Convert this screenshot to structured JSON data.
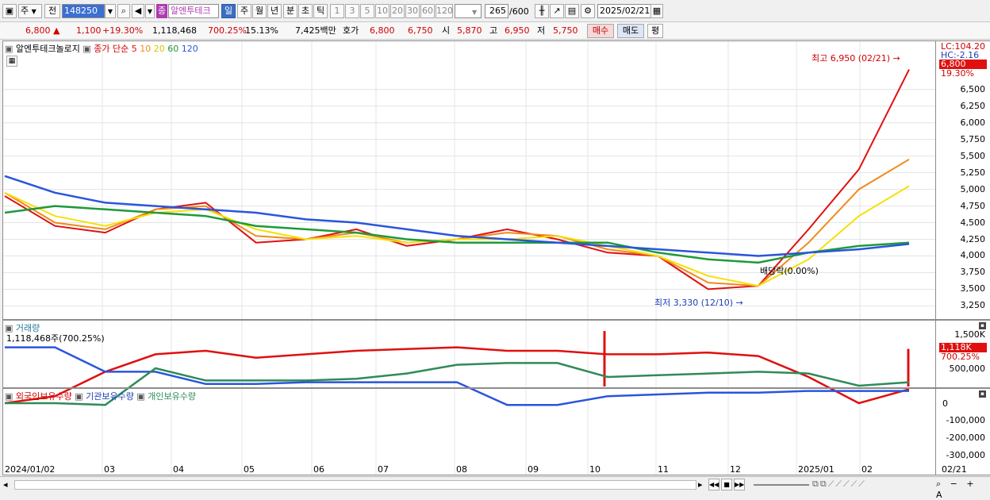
{
  "toolbar": {
    "market_type": "주",
    "prev_label": "전",
    "stock_code": "148250",
    "stock_badge": "종",
    "stock_name": "알엔투테크",
    "periods": [
      "일",
      "주",
      "월",
      "년",
      "분",
      "초",
      "틱"
    ],
    "selected_period": "일",
    "intervals": [
      "1",
      "3",
      "5",
      "10",
      "20",
      "30",
      "60",
      "120"
    ],
    "count": "265",
    "count_max": "/600",
    "date": "2025/02/21"
  },
  "quote": {
    "price": "6,800",
    "change": "1,100",
    "change_rate": "+19.30%",
    "volume": "1,118,468",
    "volume_ratio": "700.25%",
    "turnover": "15.13%",
    "amount": "7,425백만",
    "hoga_label": "호가",
    "ask": "6,800",
    "bid": "6,750",
    "open_label": "시",
    "open": "5,870",
    "high_label": "고",
    "high": "6,950",
    "low_label": "저",
    "low": "5,750",
    "buy_button": "매수",
    "sell_button": "매도",
    "eval_button": "평"
  },
  "price_pane": {
    "legend_name": "알엔투테크놀로지",
    "legend_indicator": "종가 단순",
    "ma_periods": [
      "5",
      "10",
      "20",
      "60",
      "120"
    ],
    "ma_colors": [
      "#e01010",
      "#f08a1c",
      "#f5e00a",
      "#1e9a3a",
      "#2a55dc"
    ],
    "high_annotation": "최고 6,950 (02/21)",
    "low_annotation": "최저 3,330 (12/10)",
    "dividend_annotation": "배당락(0.00%)",
    "lc_label": "LC:104.20",
    "hc_label": "HC:-2.16",
    "price_tag": "6,800",
    "rate_tag": "19.30%",
    "y_ticks": [
      "6,500",
      "6,250",
      "6,000",
      "5,750",
      "5,500",
      "5,250",
      "5,000",
      "4,750",
      "4,500",
      "4,250",
      "4,000",
      "3,750",
      "3,500",
      "3,250"
    ]
  },
  "volume_pane": {
    "title": "거래량",
    "value": "1,118,468주(700.25%)",
    "tag_value": "1,118K",
    "tag_rate": "700.25%",
    "y_ticks": [
      "1,500K",
      "1,000K",
      "500,000"
    ]
  },
  "holding_pane": {
    "series": [
      "외국인보유수량",
      "기관보유수량",
      "개인보유수량"
    ],
    "series_colors": [
      "#e01010",
      "#2a55dc",
      "#2e8b57"
    ],
    "y_ticks": [
      "0",
      "-100,000",
      "-200,000",
      "-300,000"
    ]
  },
  "x_axis": {
    "labels": [
      "2024/01/02",
      "03",
      "04",
      "05",
      "06",
      "07",
      "08",
      "09",
      "10",
      "11",
      "12",
      "2025/01",
      "02",
      "02/21"
    ]
  },
  "chart_data": {
    "type": "line",
    "title": "알엔투테크놀로지",
    "ma_series": [
      {
        "name": "5",
        "values": [
          4900,
          4450,
          4350,
          4700,
          4800,
          4200,
          4250,
          4400,
          4150,
          4250,
          4400,
          4250,
          4050,
          4000,
          3500,
          3550,
          4400,
          5300,
          6800
        ]
      },
      {
        "name": "10",
        "values": [
          4950,
          4500,
          4400,
          4700,
          4750,
          4300,
          4250,
          4350,
          4200,
          4250,
          4350,
          4300,
          4100,
          4000,
          3600,
          3550,
          4200,
          5000,
          5450
        ]
      },
      {
        "name": "20",
        "values": [
          4950,
          4600,
          4450,
          4650,
          4700,
          4400,
          4250,
          4300,
          4200,
          4250,
          4250,
          4300,
          4150,
          4000,
          3700,
          3550,
          3950,
          4600,
          5050
        ]
      },
      {
        "name": "60",
        "values": [
          4650,
          4750,
          4700,
          4650,
          4600,
          4450,
          4400,
          4350,
          4250,
          4200,
          4200,
          4200,
          4200,
          4050,
          3950,
          3900,
          4050,
          4150,
          4200
        ]
      },
      {
        "name": "120",
        "values": [
          5200,
          4950,
          4800,
          4750,
          4700,
          4650,
          4550,
          4500,
          4400,
          4300,
          4250,
          4200,
          4150,
          4100,
          4050,
          4000,
          4050,
          4100,
          4180
        ]
      }
    ],
    "volume_spikes": [
      {
        "label": "2024/10",
        "value": 1650000
      },
      {
        "label": "2025/02/21",
        "value": 1118468
      }
    ],
    "ylim": [
      3250,
      6950
    ]
  }
}
